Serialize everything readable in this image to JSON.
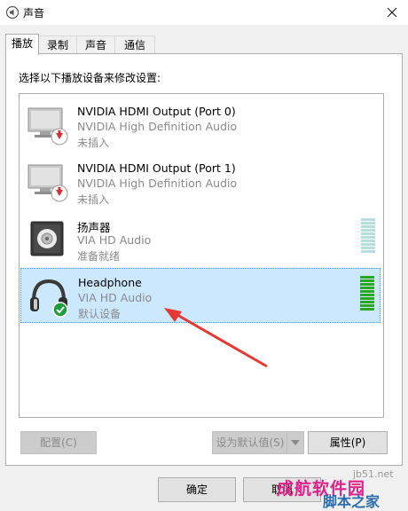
{
  "window": {
    "title": "声音",
    "icon": "speaker-app-icon"
  },
  "tabs": [
    {
      "label": "播放",
      "active": true
    },
    {
      "label": "录制",
      "active": false
    },
    {
      "label": "声音",
      "active": false
    },
    {
      "label": "通信",
      "active": false
    }
  ],
  "instruction": "选择以下播放设备来修改设置:",
  "devices": [
    {
      "name": "NVIDIA HDMI Output (Port 0)",
      "driver": "NVIDIA High Definition Audio",
      "status": "未插入",
      "icon": "monitor-unplugged-icon"
    },
    {
      "name": "NVIDIA HDMI Output (Port 1)",
      "driver": "NVIDIA High Definition Audio",
      "status": "未插入",
      "icon": "monitor-unplugged-icon"
    },
    {
      "name": "扬声器",
      "driver": "VIA HD Audio",
      "status": "准备就绪",
      "icon": "speaker-icon"
    },
    {
      "name": "Headphone",
      "driver": "VIA HD Audio",
      "status": "默认设备",
      "icon": "headphone-default-icon",
      "selected": true
    }
  ],
  "buttons": {
    "configure": "配置(C)",
    "set_default": "设为默认值(S)",
    "properties": "属性(P)",
    "ok": "确定",
    "cancel": "取消"
  },
  "watermark": {
    "line1": "成航软件园",
    "line2": "脚本之家",
    "url": "jb51.net"
  },
  "colors": {
    "selection": "#cce8ff",
    "meter_active": "#2ba52b",
    "meter_idle": "#b7dfe0",
    "arrow": "#e53935"
  }
}
